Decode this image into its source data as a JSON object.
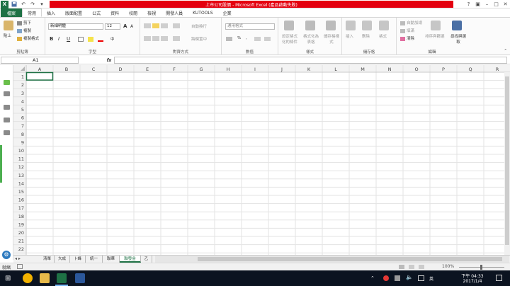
{
  "window": {
    "title": "上市公司股價 - Microsoft Excel (產品啟動失敗)"
  },
  "tabs": [
    "檔案",
    "常用",
    "插入",
    "版面配置",
    "公式",
    "資料",
    "校閱",
    "檢視",
    "開發人員",
    "KUTOOLS",
    "企業"
  ],
  "ribbon": {
    "clipboard": {
      "group": "剪貼簿",
      "paste": "貼上",
      "cut": "剪下",
      "copy": "複製",
      "format_painter": "複製格式"
    },
    "font": {
      "group": "字型",
      "font_name": "新細明體",
      "font_size": "12",
      "bold": "B",
      "italic": "I",
      "underline": "U",
      "grow": "A",
      "shrink": "A",
      "phonetic": "中"
    },
    "alignment": {
      "group": "對齊方式",
      "wrap": "自動換行",
      "merge": "跨欄置中"
    },
    "number": {
      "group": "數值",
      "format": "通用格式",
      "percent": "%",
      "comma": ","
    },
    "styles": {
      "group": "樣式",
      "conditional": "設定格式化的條件",
      "as_table": "格式化為表格",
      "cell_styles": "儲存格樣式"
    },
    "cells": {
      "group": "儲存格",
      "insert": "插入",
      "delete": "刪除",
      "format": "格式"
    },
    "editing": {
      "group": "編輯",
      "autosum": "自動加總",
      "fill": "填滿",
      "clear": "清除",
      "sort": "排序與篩選",
      "find": "尋找與選取"
    }
  },
  "formula_bar": {
    "name_box": "A1",
    "fx": "fx",
    "value": ""
  },
  "columns": [
    "A",
    "B",
    "C",
    "D",
    "E",
    "F",
    "G",
    "H",
    "I",
    "J",
    "K",
    "L",
    "M",
    "N",
    "O",
    "P",
    "Q",
    "R"
  ],
  "rows": [
    "1",
    "2",
    "3",
    "4",
    "5",
    "6",
    "7",
    "8",
    "9",
    "10",
    "11",
    "12",
    "13",
    "14",
    "15",
    "16",
    "17",
    "18",
    "19",
    "20",
    "21",
    "22"
  ],
  "sheets": [
    "清單",
    "大成",
    "卜蜂",
    "統一",
    "聯華",
    "聯發金",
    "乙"
  ],
  "active_sheet": "聯發金",
  "status": {
    "ready": "就緒",
    "zoom": "100%"
  },
  "taskbar": {
    "time": "下午 04:33",
    "date": "2017/1/4"
  }
}
